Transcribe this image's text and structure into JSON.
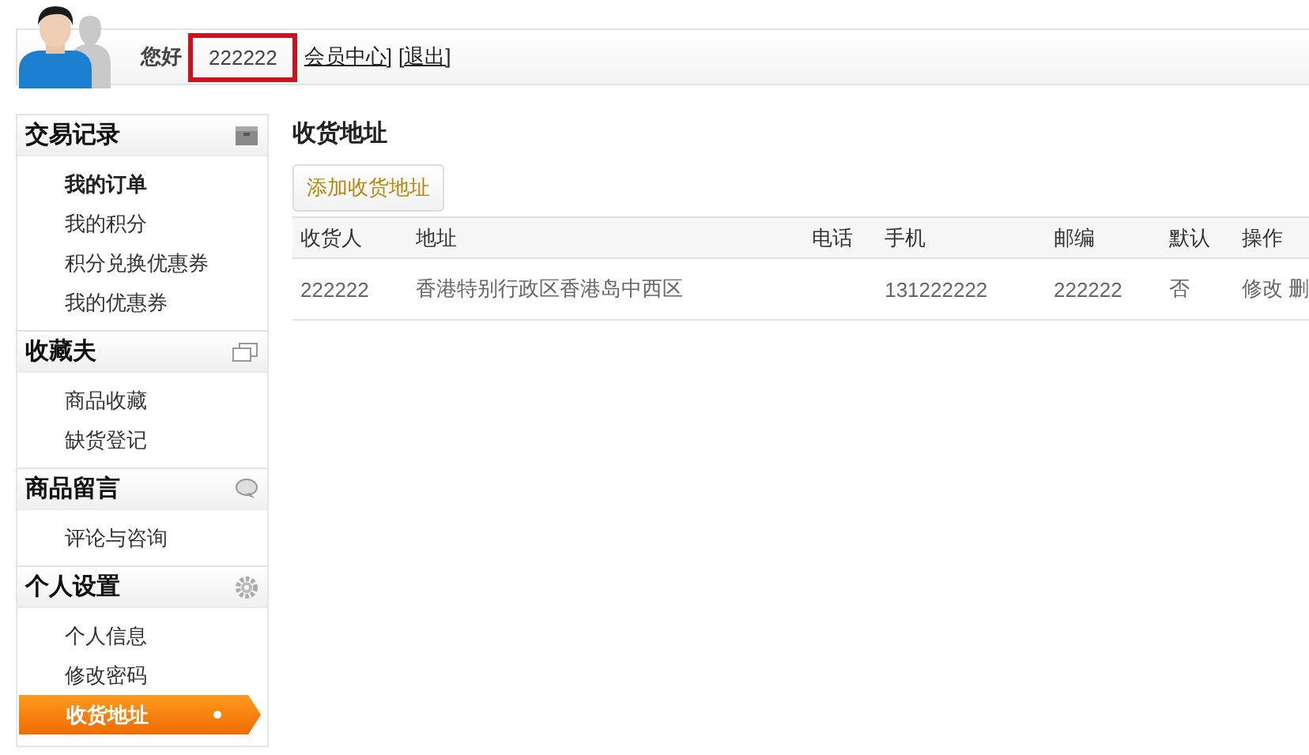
{
  "header": {
    "greeting": "您好",
    "username": "222222",
    "highlighted": true,
    "links": [
      {
        "label": "会员中心]"
      },
      {
        "label": "[退出]"
      }
    ]
  },
  "sidebar": [
    {
      "title": "交易记录",
      "items": [
        {
          "label": "我的订单",
          "selected": false,
          "bold": true
        },
        {
          "label": "我的积分",
          "selected": false,
          "bold": false
        },
        {
          "label": "积分兑换优惠券",
          "selected": false,
          "bold": false
        },
        {
          "label": "我的优惠券",
          "selected": false,
          "bold": false
        }
      ]
    },
    {
      "title": "收藏夫",
      "items": [
        {
          "label": "商品收藏",
          "selected": false,
          "bold": false
        },
        {
          "label": "缺货登记",
          "selected": false,
          "bold": false
        }
      ]
    },
    {
      "title": "商品留言",
      "items": [
        {
          "label": "评论与咨询",
          "selected": false,
          "bold": false
        }
      ]
    },
    {
      "title": "个人设置",
      "items": [
        {
          "label": "个人信息",
          "selected": false,
          "bold": false
        },
        {
          "label": "修改密码",
          "selected": false,
          "bold": false
        },
        {
          "label": "收货地址",
          "selected": true,
          "bold": true
        }
      ]
    }
  ],
  "main": {
    "title": "收货地址",
    "add_button": "添加收货地址",
    "table": {
      "columns": [
        "收货人",
        "地址",
        "电话",
        "手机",
        "邮编",
        "默认",
        "操作"
      ],
      "rows": [
        {
          "cells": [
            "222222",
            "香港特别行政区香港岛中西区",
            "",
            "131222222",
            "222222",
            "否"
          ],
          "actions": [
            "修改",
            "删"
          ]
        }
      ]
    }
  }
}
